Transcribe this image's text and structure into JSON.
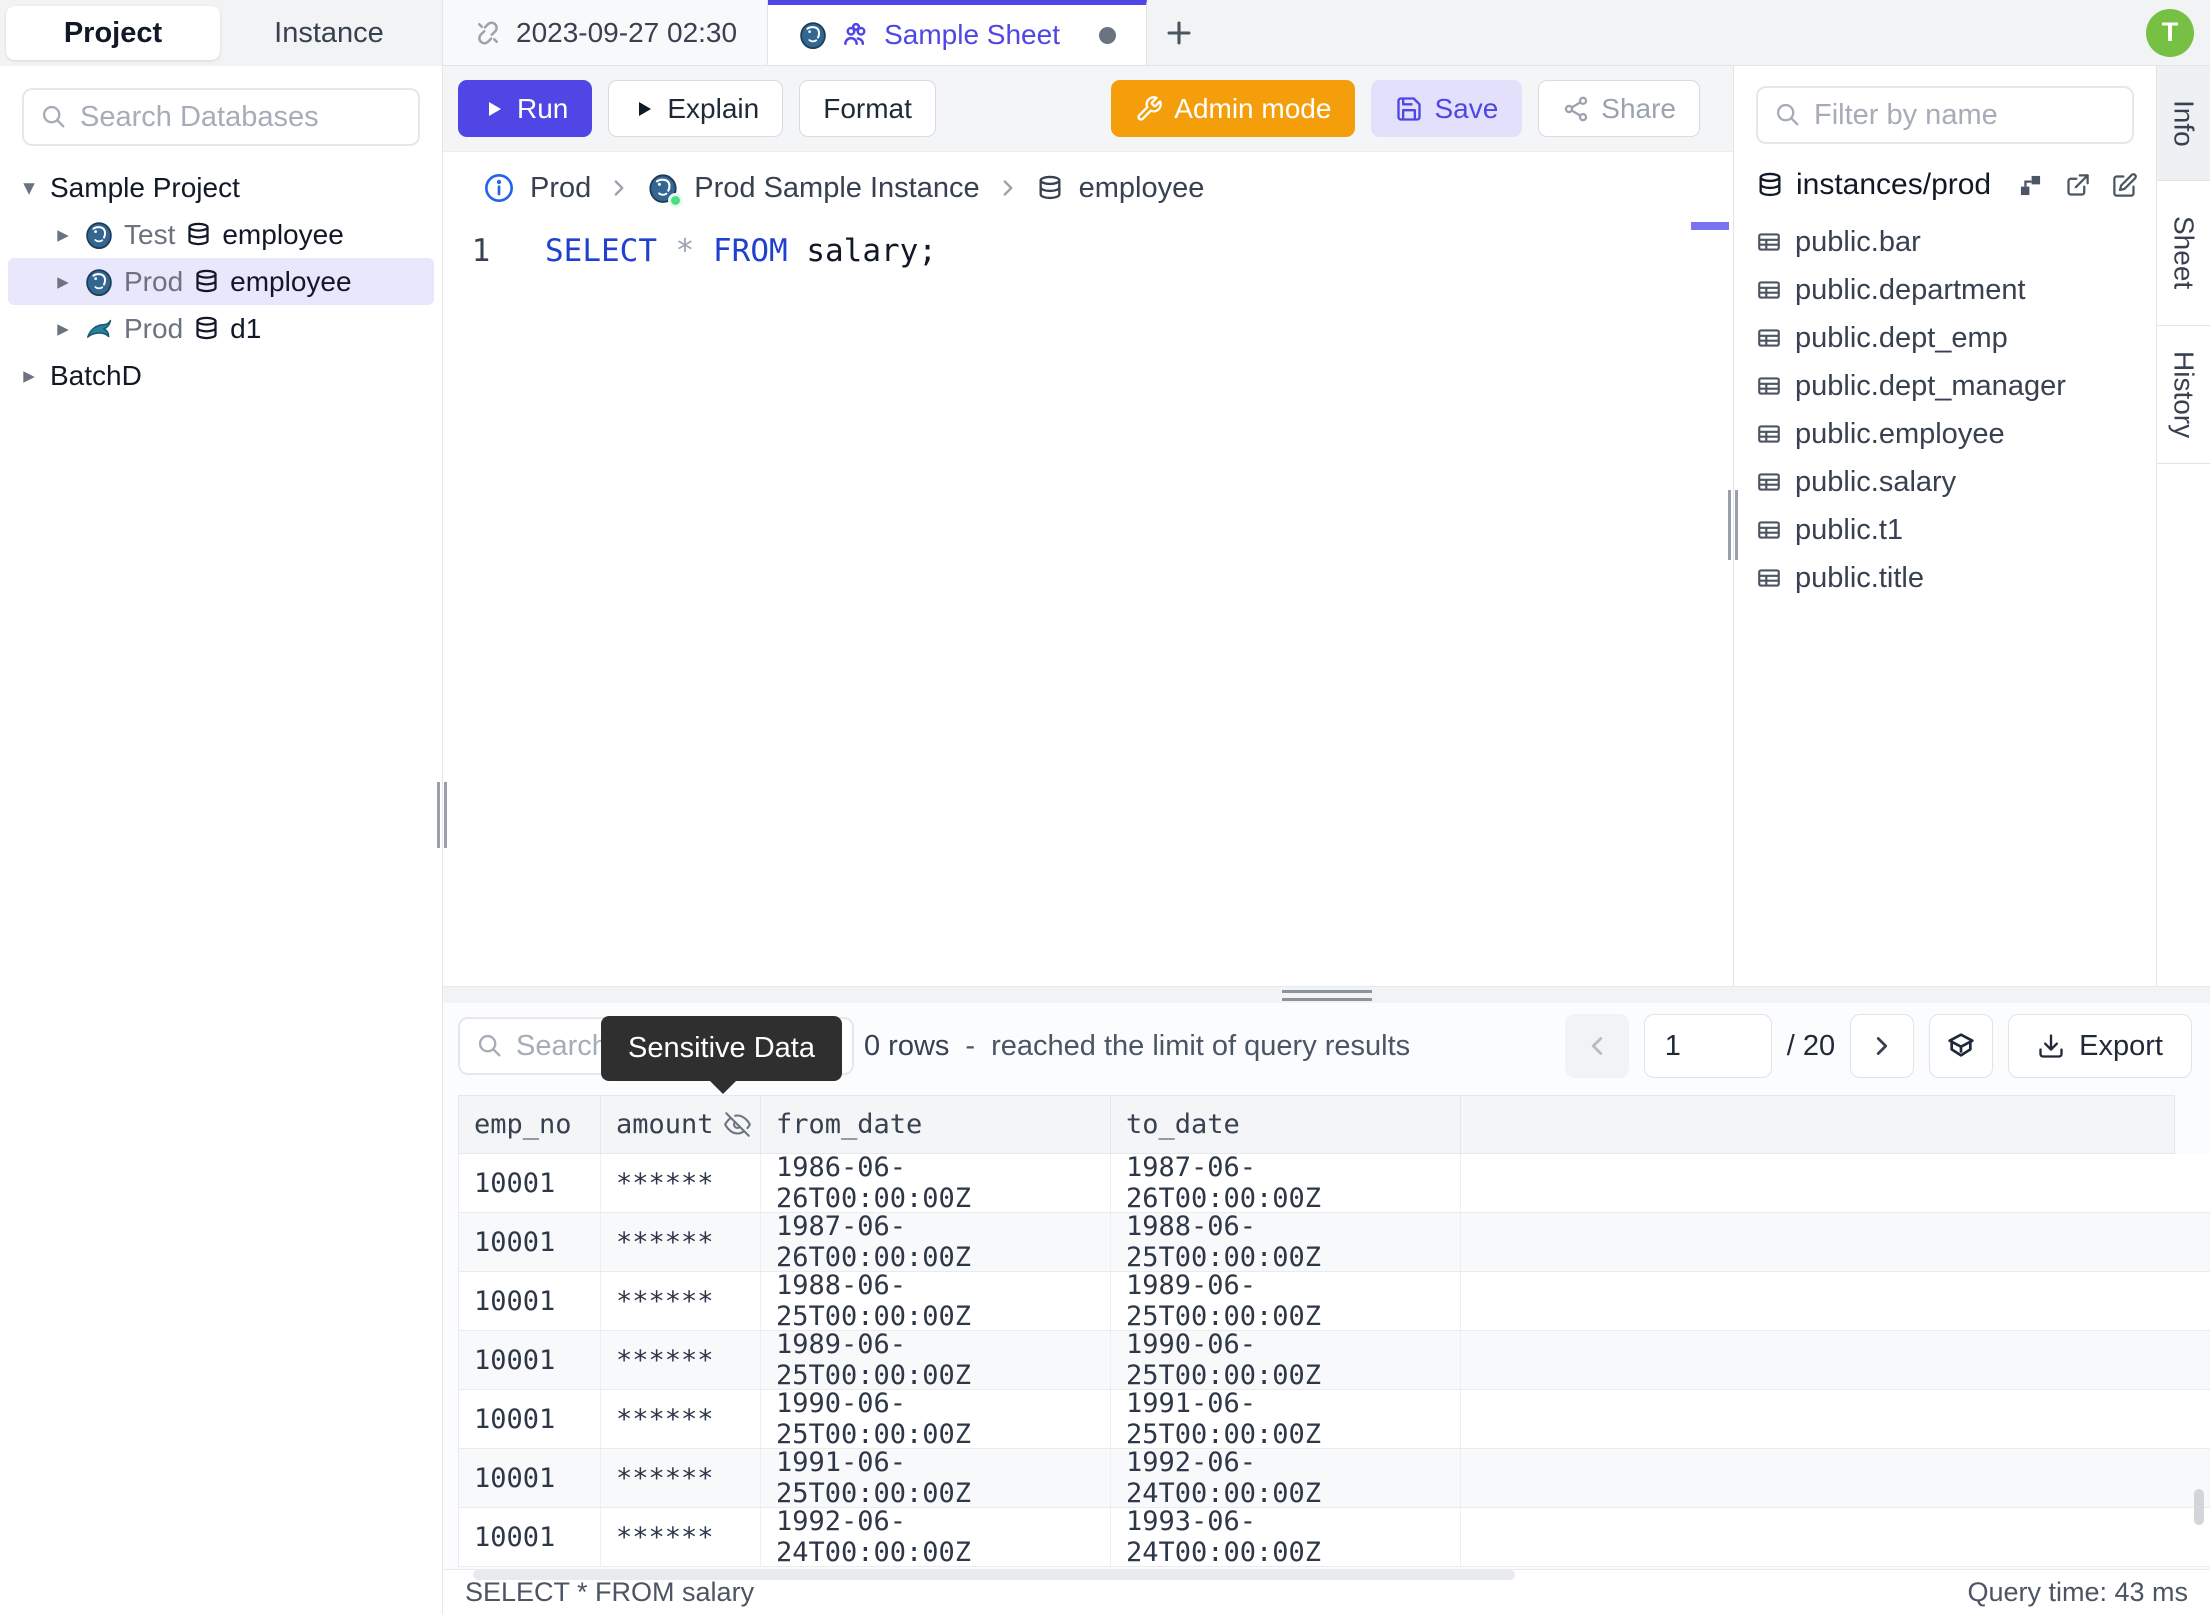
{
  "colors": {
    "accent_indigo": "#4f46e5",
    "admin_orange": "#f59e0b",
    "avatar_green": "#76c043",
    "keyword_blue": "#2041cd",
    "tooltip_bg": "#2f2f2f",
    "selected_row_bg": "#e8e7fc"
  },
  "left_sidebar": {
    "tabs": {
      "project": "Project",
      "instance": "Instance"
    },
    "search_placeholder": "Search Databases",
    "tree": {
      "root_project": "Sample Project",
      "row1": {
        "env": "Test",
        "database": "employee",
        "engine": "postgres"
      },
      "row2": {
        "env": "Prod",
        "database": "employee",
        "engine": "postgres"
      },
      "row3": {
        "env": "Prod",
        "database": "d1",
        "engine": "mysql"
      },
      "batch_project": "BatchD"
    }
  },
  "tab_bar": {
    "tab1_label": "2023-09-27 02:30",
    "tab2_label": "Sample Sheet",
    "add_label": "+",
    "avatar_initial": "T"
  },
  "toolbar": {
    "run_label": "Run",
    "explain_label": "Explain",
    "format_label": "Format",
    "admin_label": "Admin mode",
    "save_label": "Save",
    "share_label": "Share"
  },
  "breadcrumb": {
    "environment": "Prod",
    "instance": "Prod Sample Instance",
    "database": "employee"
  },
  "editor": {
    "line_number": "1",
    "kw1": "SELECT",
    "op": "*",
    "kw2": "FROM",
    "rest": "salary;"
  },
  "right_sidebar": {
    "filter_placeholder": "Filter by name",
    "connection": "instances/prod",
    "tables": [
      "public.bar",
      "public.department",
      "public.dept_emp",
      "public.dept_manager",
      "public.employee",
      "public.salary",
      "public.t1",
      "public.title"
    ],
    "vtabs": {
      "info": "Info",
      "sheet": "Sheet",
      "history": "History"
    }
  },
  "results": {
    "search_placeholder": "Search",
    "tooltip": "Sensitive Data",
    "row_count": "0 rows",
    "dash": "-",
    "limit_note": "reached the limit of query results",
    "page_current": "1",
    "page_total": "/ 20",
    "export_label": "Export",
    "table": {
      "columns": [
        "emp_no",
        "amount",
        "from_date",
        "to_date"
      ],
      "rows": [
        [
          "10001",
          "******",
          "1986-06-26T00:00:00Z",
          "1987-06-26T00:00:00Z"
        ],
        [
          "10001",
          "******",
          "1987-06-26T00:00:00Z",
          "1988-06-25T00:00:00Z"
        ],
        [
          "10001",
          "******",
          "1988-06-25T00:00:00Z",
          "1989-06-25T00:00:00Z"
        ],
        [
          "10001",
          "******",
          "1989-06-25T00:00:00Z",
          "1990-06-25T00:00:00Z"
        ],
        [
          "10001",
          "******",
          "1990-06-25T00:00:00Z",
          "1991-06-25T00:00:00Z"
        ],
        [
          "10001",
          "******",
          "1991-06-25T00:00:00Z",
          "1992-06-24T00:00:00Z"
        ],
        [
          "10001",
          "******",
          "1992-06-24T00:00:00Z",
          "1993-06-24T00:00:00Z"
        ]
      ]
    }
  },
  "status_bar": {
    "left": "SELECT * FROM salary",
    "right": "Query time: 43 ms"
  }
}
